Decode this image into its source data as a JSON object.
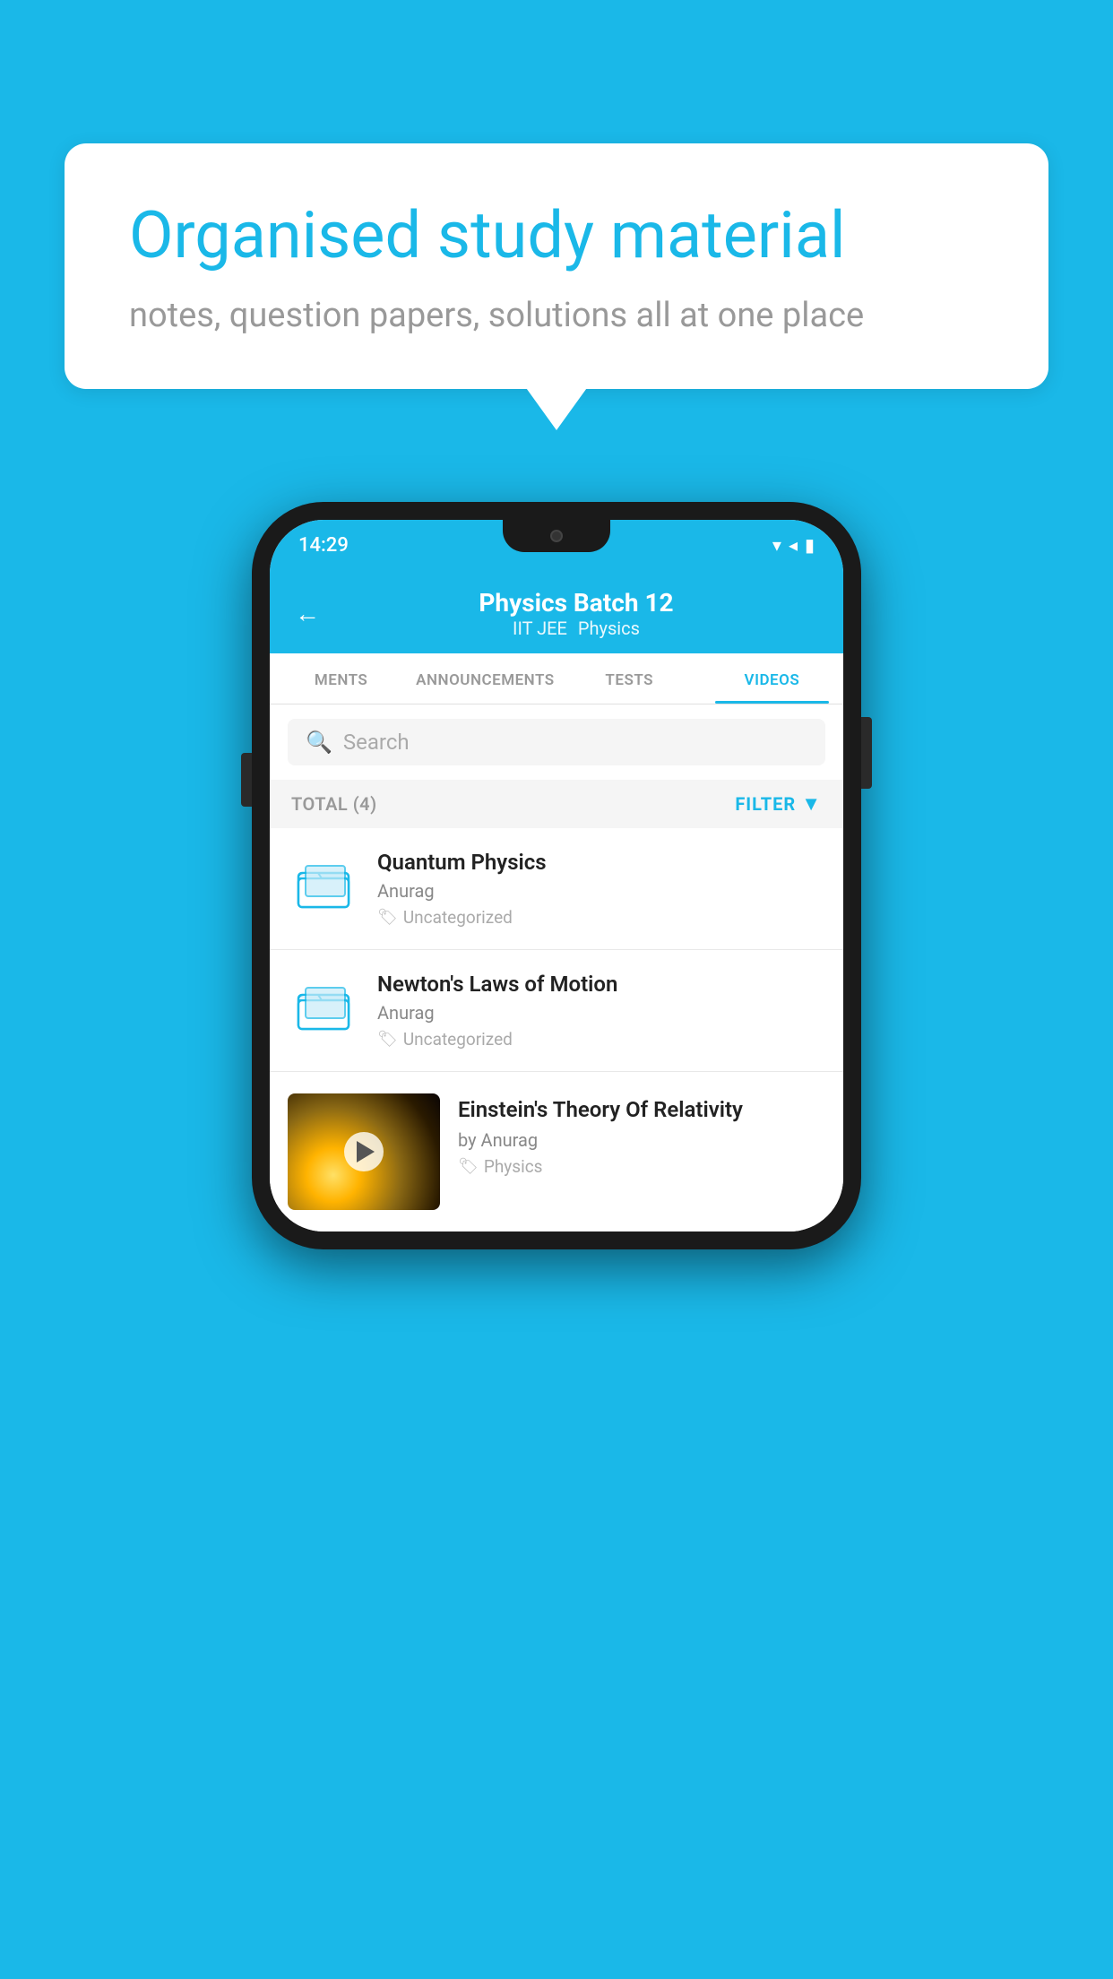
{
  "bubble": {
    "title": "Organised study material",
    "subtitle": "notes, question papers, solutions all at one place"
  },
  "phone": {
    "statusBar": {
      "time": "14:29",
      "icons": "▾◂▮"
    },
    "header": {
      "backLabel": "←",
      "title": "Physics Batch 12",
      "subtitle1": "IIT JEE",
      "subtitle2": "Physics"
    },
    "tabs": [
      {
        "label": "MENTS",
        "active": false
      },
      {
        "label": "ANNOUNCEMENTS",
        "active": false
      },
      {
        "label": "TESTS",
        "active": false
      },
      {
        "label": "VIDEOS",
        "active": true
      }
    ],
    "search": {
      "placeholder": "Search"
    },
    "filterBar": {
      "total": "TOTAL (4)",
      "filterLabel": "FILTER"
    },
    "videos": [
      {
        "id": 1,
        "title": "Quantum Physics",
        "author": "Anurag",
        "tag": "Uncategorized",
        "type": "folder"
      },
      {
        "id": 2,
        "title": "Newton's Laws of Motion",
        "author": "Anurag",
        "tag": "Uncategorized",
        "type": "folder"
      },
      {
        "id": 3,
        "title": "Einstein's Theory Of Relativity",
        "author": "by Anurag",
        "tag": "Physics",
        "type": "video"
      }
    ]
  }
}
